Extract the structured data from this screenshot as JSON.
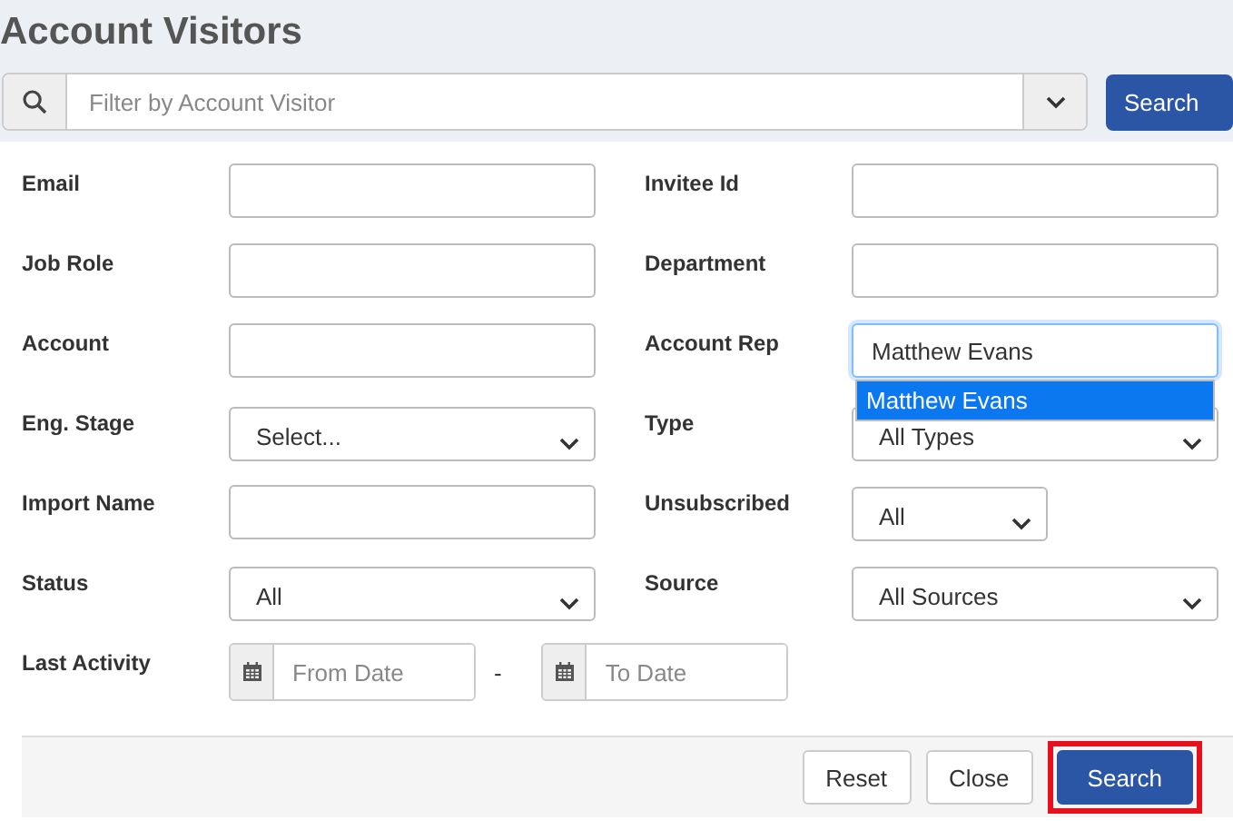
{
  "title": "Account Visitors",
  "filter": {
    "placeholder": "Filter by Account Visitor",
    "button": "Search"
  },
  "rows": [
    {
      "left": {
        "label": "Email",
        "kind": "text"
      },
      "right": {
        "label": "Invitee Id",
        "kind": "text"
      }
    },
    {
      "left": {
        "label": "Job Role",
        "kind": "text"
      },
      "right": {
        "label": "Department",
        "kind": "text"
      }
    },
    {
      "left": {
        "label": "Account",
        "kind": "text"
      },
      "right": {
        "label": "Account Rep",
        "kind": "text",
        "value": "Matthew Evans",
        "focused": true,
        "suggestions": [
          {
            "label": "Matthew Evans",
            "selected": true
          }
        ]
      }
    },
    {
      "left": {
        "label": "Eng. Stage",
        "kind": "select",
        "value": "Select..."
      },
      "right": {
        "label": "Type",
        "kind": "select",
        "value": "All Types"
      }
    },
    {
      "left": {
        "label": "Import Name",
        "kind": "text"
      },
      "right": {
        "label": "Unsubscribed",
        "kind": "select-short",
        "value": "All"
      }
    },
    {
      "left": {
        "label": "Status",
        "kind": "select",
        "value": "All"
      },
      "right": {
        "label": "Source",
        "kind": "select",
        "value": "All Sources"
      }
    },
    {
      "left": {
        "label": "Last Activity",
        "kind": "date-range",
        "from_placeholder": "From Date",
        "separator": "-",
        "to_placeholder": "To Date"
      }
    }
  ],
  "footer": {
    "buttons": [
      {
        "label": "Reset",
        "kind": "default",
        "highlighted": false
      },
      {
        "label": "Close",
        "kind": "default",
        "highlighted": false
      },
      {
        "label": "Search",
        "kind": "primary",
        "highlighted": true
      }
    ]
  }
}
